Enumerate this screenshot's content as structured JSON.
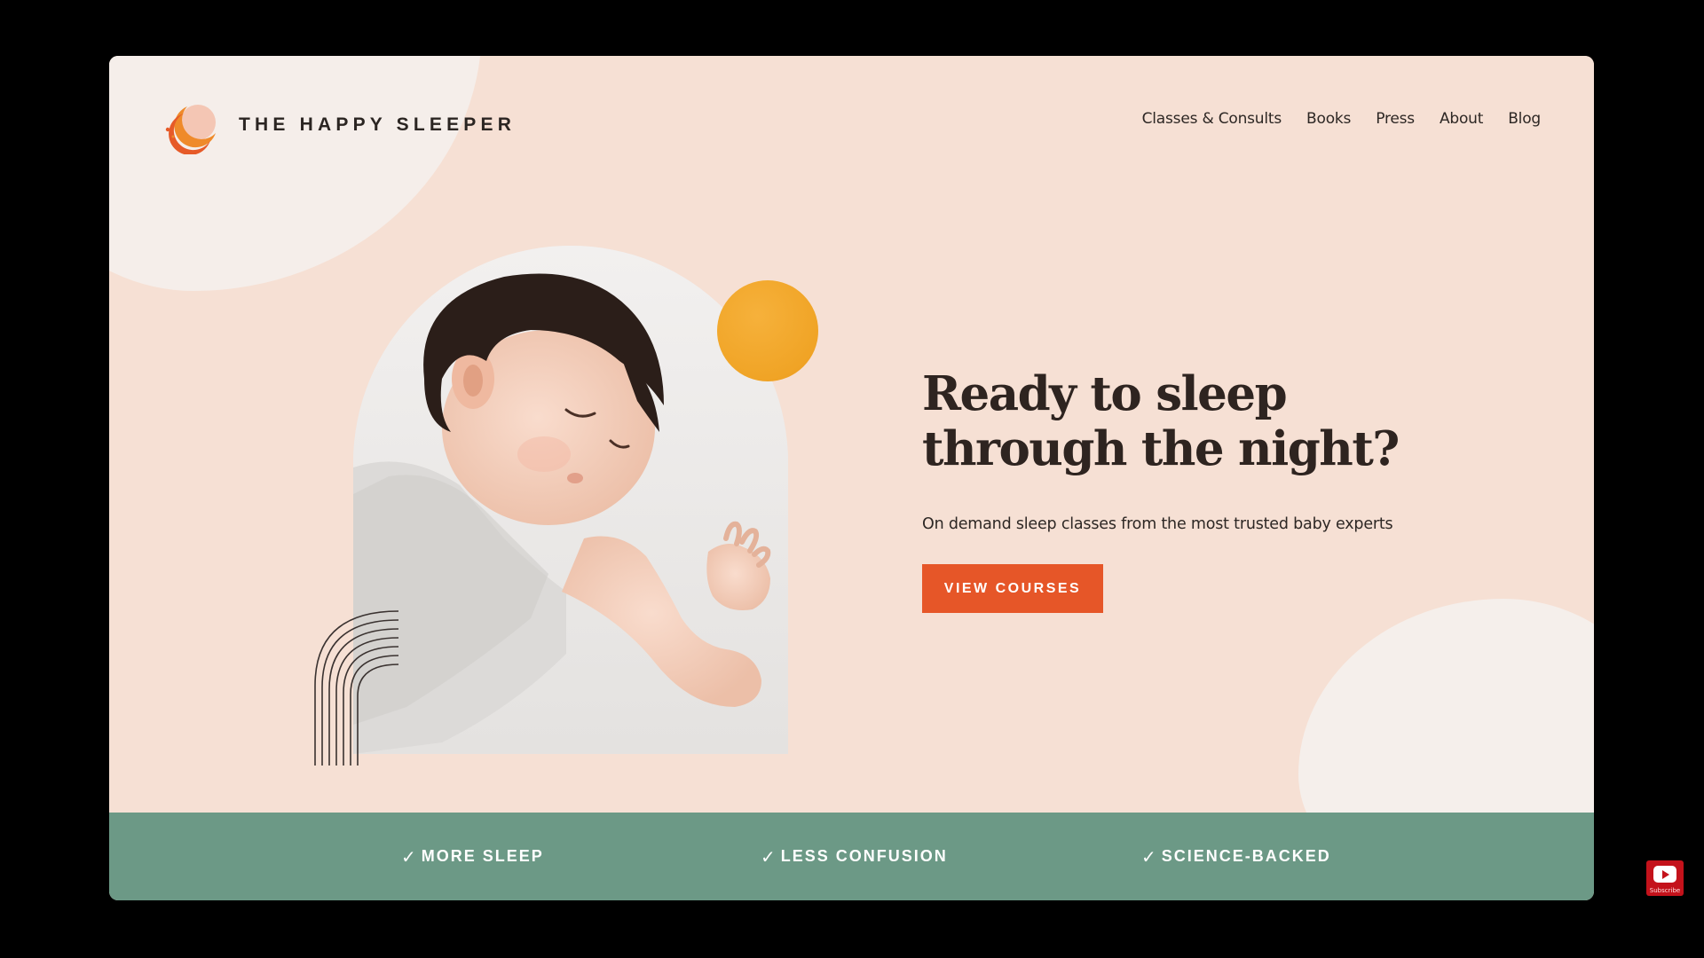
{
  "brand": {
    "name": "THE HAPPY SLEEPER",
    "logo_icon": "crescent-moon-icon",
    "colors": {
      "accent": "#e65628",
      "moon_orange": "#f0a426",
      "strip_green": "#6c9986",
      "background": "#f6e0d4"
    }
  },
  "nav": {
    "items": [
      {
        "label": "Classes & Consults"
      },
      {
        "label": "Books"
      },
      {
        "label": "Press"
      },
      {
        "label": "About"
      },
      {
        "label": "Blog"
      }
    ]
  },
  "hero": {
    "headline_line1": "Ready to sleep",
    "headline_line2": "through the night?",
    "subtitle": "On demand sleep classes from the most trusted baby experts",
    "cta_label": "VIEW COURSES",
    "image_alt": "sleeping-baby-photo"
  },
  "benefits": {
    "items": [
      {
        "icon": "check-icon",
        "check": "✓",
        "label": "MORE SLEEP"
      },
      {
        "icon": "check-icon",
        "check": "✓",
        "label": "LESS CONFUSION"
      },
      {
        "icon": "check-icon",
        "check": "✓",
        "label": "SCIENCE-BACKED"
      }
    ]
  },
  "overlay": {
    "youtube_subscribe": "Subscribe"
  }
}
